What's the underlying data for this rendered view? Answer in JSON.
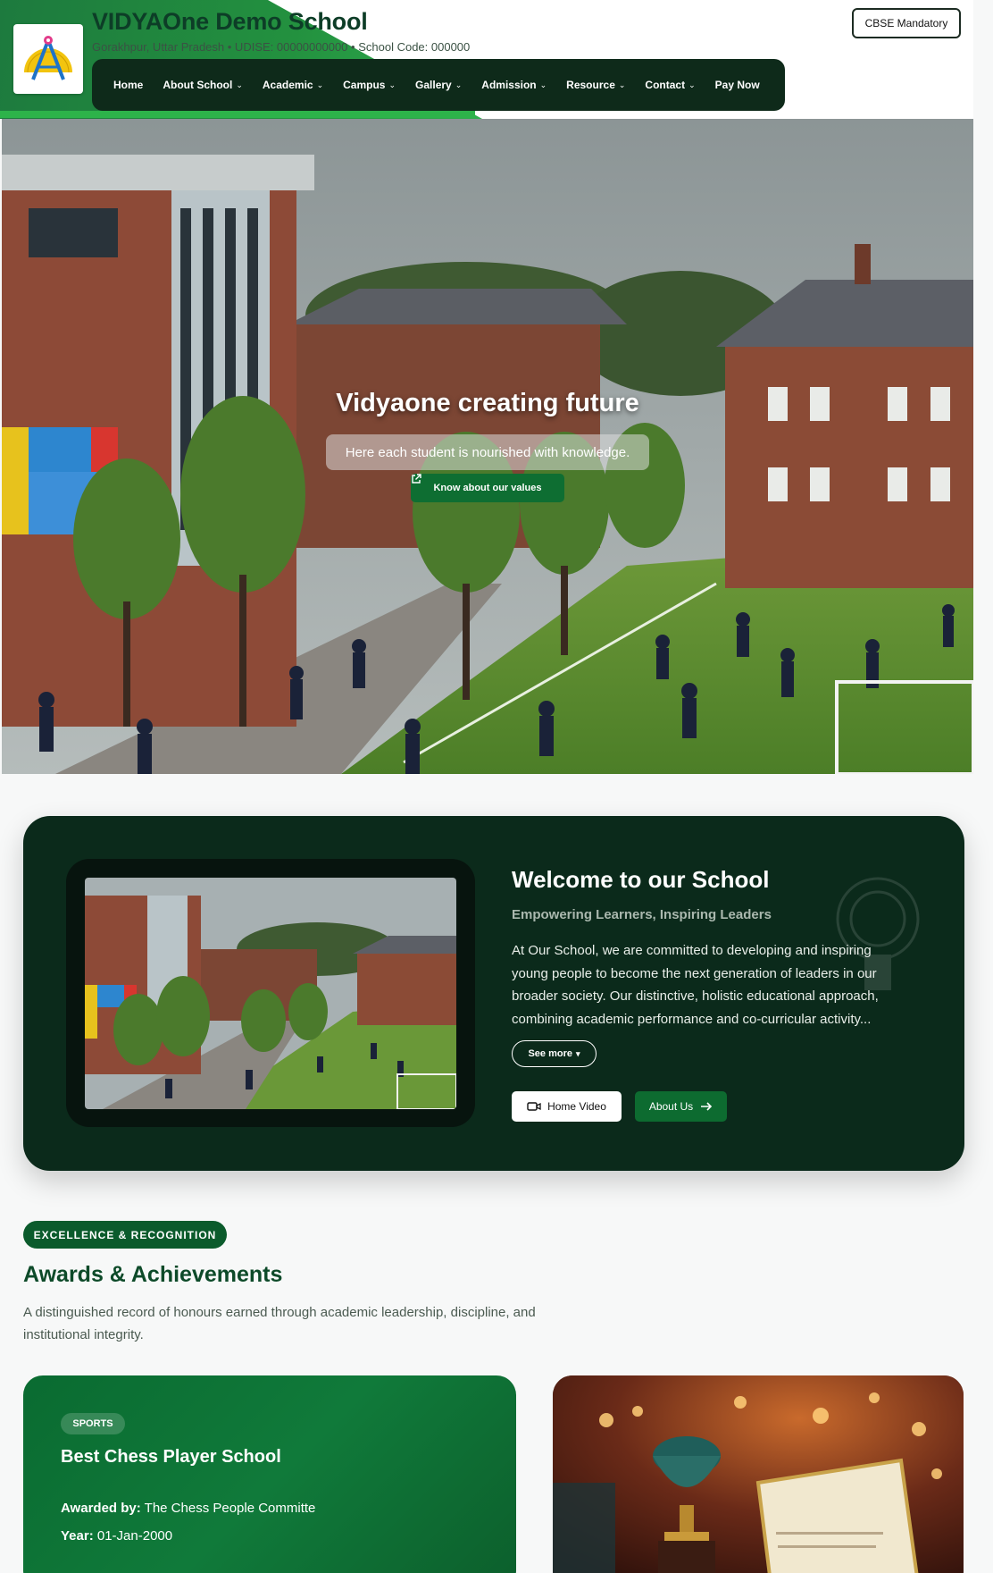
{
  "header": {
    "school_name": "VIDYAOne Demo School",
    "location": "Gorakhpur, Uttar Pradesh",
    "udise": "• UDISE: 00000000000",
    "school_code": "• School Code: 000000",
    "cbse_label": "CBSE Mandatory"
  },
  "nav": {
    "items": [
      {
        "label": "Home",
        "dropdown": false
      },
      {
        "label": "About School",
        "dropdown": true
      },
      {
        "label": "Academic",
        "dropdown": true
      },
      {
        "label": "Campus",
        "dropdown": true
      },
      {
        "label": "Gallery",
        "dropdown": true
      },
      {
        "label": "Admission",
        "dropdown": true
      },
      {
        "label": "Resource",
        "dropdown": true
      },
      {
        "label": "Contact",
        "dropdown": true
      },
      {
        "label": "Pay Now",
        "dropdown": false
      }
    ]
  },
  "hero": {
    "title": "Vidyaone creating future",
    "subtitle": "Here each student is nourished with knowledge.",
    "cta_label": "Know about our values"
  },
  "welcome": {
    "title": "Welcome to our School",
    "subtitle": "Empowering Learners, Inspiring Leaders",
    "body": "At Our School, we are committed to developing and inspiring young people to become the next generation of leaders in our broader society. Our distinctive, holistic educational approach, combining academic performance and co-curricular activity...",
    "see_more_label": "See more",
    "home_video_label": "Home Video",
    "about_us_label": "About Us"
  },
  "awards": {
    "tag": "EXCELLENCE & RECOGNITION",
    "title": "Awards & Achievements",
    "description": "A distinguished record of honours earned through academic leadership, discipline, and institutional integrity.",
    "items": [
      {
        "category": "SPORTS",
        "title": "Best Chess Player School",
        "awarded_by_label": "Awarded by:",
        "awarded_by": "The Chess People Committe",
        "year_label": "Year:",
        "year": "01-Jan-2000"
      }
    ]
  },
  "colors": {
    "brand_green": "#0d6b30",
    "dark_green": "#0b2a1b",
    "accent_green": "#2db34a"
  }
}
